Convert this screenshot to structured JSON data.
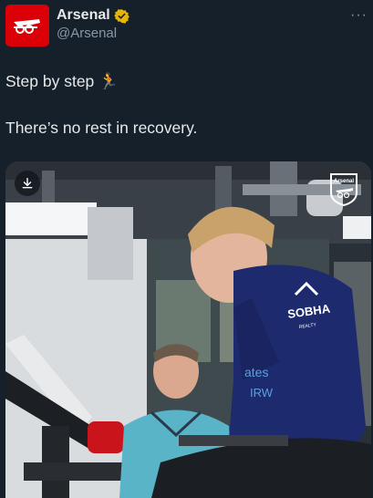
{
  "account": {
    "name": "Arsenal",
    "handle": "@Arsenal",
    "avatar_color": "#db0007",
    "verified_color": "#e8b500"
  },
  "menu": {
    "icon": "more-horizontal-icon",
    "label": "···"
  },
  "tweet": {
    "line1": "Step by step 🏃",
    "line2": "There’s no rest in recovery."
  },
  "media": {
    "download_icon": "download-icon",
    "crest_icon": "arsenal-crest-icon",
    "crest_text": "Arsenal",
    "shirt_text": "SOBHA",
    "shirt_subtext": "REALTY"
  }
}
